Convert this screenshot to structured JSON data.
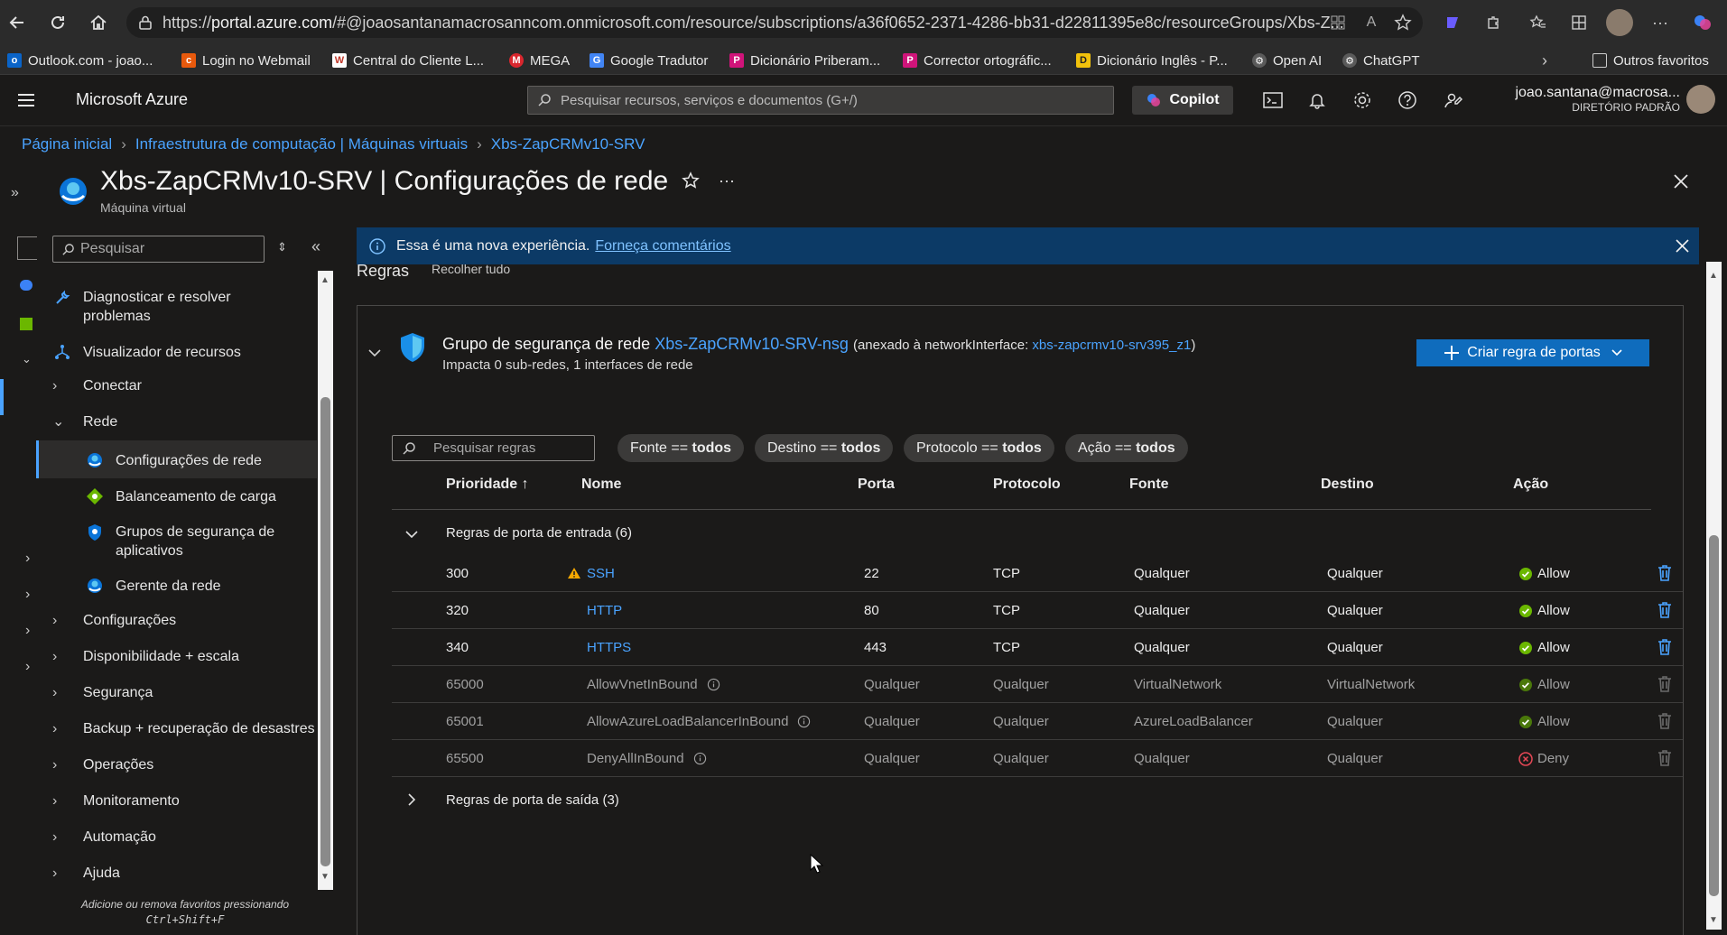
{
  "browser": {
    "url_prefix": "https://",
    "url_host": "portal.azure.com",
    "url_rest": "/#@joaosantanamacrosanncom.onmicrosoft.com/resource/subscriptions/a36f0652-2371-4286-bb31-d22811395e8c/resourceGroups/Xbs-Z...",
    "bookmarks": [
      {
        "label": "Outlook.com - joao...",
        "icon": "outlook-icon",
        "color": "#0a64c8"
      },
      {
        "label": "Login no Webmail",
        "icon": "cpanel-icon",
        "color": "#e8590c"
      },
      {
        "label": "Central do Cliente L...",
        "icon": "w-icon",
        "color": "#c0392b"
      },
      {
        "label": "MEGA",
        "icon": "mega-icon",
        "color": "#d9272e"
      },
      {
        "label": "Google Tradutor",
        "icon": "translate-icon",
        "color": "#4285f4"
      },
      {
        "label": "Dicionário Priberam...",
        "icon": "priberam-icon",
        "color": "#d0147a"
      },
      {
        "label": "Corrector ortográfic...",
        "icon": "priberam-icon",
        "color": "#d0147a"
      },
      {
        "label": "Dicionário Inglês - P...",
        "icon": "dictionary-icon",
        "color": "#f2c20c"
      },
      {
        "label": "Open AI",
        "icon": "openai-icon",
        "color": "#5a5a5a"
      },
      {
        "label": "ChatGPT",
        "icon": "openai-icon",
        "color": "#5a5a5a"
      }
    ],
    "other_favorites": "Outros favoritos"
  },
  "azure": {
    "brand": "Microsoft Azure",
    "search_placeholder": "Pesquisar recursos, serviços e documentos (G+/)",
    "copilot": "Copilot",
    "user_email": "joao.santana@macrosa...",
    "user_dir": "DIRETÓRIO PADRÃO"
  },
  "breadcrumb": [
    "Página inicial",
    "Infraestrutura de computação | Máquinas virtuais",
    "Xbs-ZapCRMv10-SRV"
  ],
  "page": {
    "title": "Xbs-ZapCRMv10-SRV | Configurações de rede",
    "subtitle": "Máquina virtual"
  },
  "side_menu": {
    "search_placeholder": "Pesquisar",
    "items": [
      {
        "label": "Diagnosticar e resolver",
        "label2": "problemas",
        "icon": "wrench-icon",
        "type": "icon"
      },
      {
        "label": "Visualizador de recursos",
        "icon": "hierarchy-icon",
        "type": "icon"
      },
      {
        "label": "Conectar",
        "type": "collapsed"
      },
      {
        "label": "Rede",
        "type": "expanded"
      },
      {
        "label": "Configurações de rede",
        "icon": "network-settings-icon",
        "type": "sub",
        "selected": true
      },
      {
        "label": "Balanceamento de carga",
        "icon": "load-balancer-icon",
        "type": "sub"
      },
      {
        "label": "Grupos de segurança de",
        "label2": "aplicativos",
        "icon": "shield-icon",
        "type": "sub"
      },
      {
        "label": "Gerente da rede",
        "icon": "network-manager-icon",
        "type": "sub"
      },
      {
        "label": "Configurações",
        "type": "collapsed"
      },
      {
        "label": "Disponibilidade + escala",
        "type": "collapsed"
      },
      {
        "label": "Segurança",
        "type": "collapsed"
      },
      {
        "label": "Backup + recuperação de desastres",
        "type": "collapsed"
      },
      {
        "label": "Operações",
        "type": "collapsed"
      },
      {
        "label": "Monitoramento",
        "type": "collapsed"
      },
      {
        "label": "Automação",
        "type": "collapsed"
      },
      {
        "label": "Ajuda",
        "type": "collapsed"
      }
    ],
    "hint_line1": "Adicione ou remova favoritos pressionando",
    "hint_line2": "Ctrl+Shift+F"
  },
  "banner": {
    "text": "Essa é uma nova experiência.",
    "link": "Forneça comentários"
  },
  "rules_heading": "Regras",
  "collapse_all": "Recolher tudo",
  "nsg": {
    "prefix": "Grupo de segurança de rede",
    "name": "Xbs-ZapCRMv10-SRV-nsg",
    "attached_prefix": "(anexado à networkInterface:",
    "attached_nic": "xbs-zapcrmv10-srv395_z1",
    "attached_suffix": ")",
    "impact": "Impacta 0 sub-redes, 1 interfaces de rede",
    "create_button": "Criar regra de portas"
  },
  "filters": {
    "search_placeholder": "Pesquisar regras",
    "pills": [
      {
        "key": "Fonte",
        "op": "==",
        "value": "todos"
      },
      {
        "key": "Destino",
        "op": "==",
        "value": "todos"
      },
      {
        "key": "Protocolo",
        "op": "==",
        "value": "todos"
      },
      {
        "key": "Ação",
        "op": "==",
        "value": "todos"
      }
    ]
  },
  "columns": [
    "Prioridade ↑",
    "Nome",
    "Porta",
    "Protocolo",
    "Fonte",
    "Destino",
    "Ação"
  ],
  "inbound_group": "Regras de porta de entrada (6)",
  "outbound_group": "Regras de porta de saída (3)",
  "rules": [
    {
      "priority": "300",
      "name": "SSH",
      "port": "22",
      "protocol": "TCP",
      "source": "Qualquer",
      "dest": "Qualquer",
      "action": "Allow",
      "warning": true,
      "default": false
    },
    {
      "priority": "320",
      "name": "HTTP",
      "port": "80",
      "protocol": "TCP",
      "source": "Qualquer",
      "dest": "Qualquer",
      "action": "Allow",
      "warning": false,
      "default": false
    },
    {
      "priority": "340",
      "name": "HTTPS",
      "port": "443",
      "protocol": "TCP",
      "source": "Qualquer",
      "dest": "Qualquer",
      "action": "Allow",
      "warning": false,
      "default": false
    },
    {
      "priority": "65000",
      "name": "AllowVnetInBound",
      "port": "Qualquer",
      "protocol": "Qualquer",
      "source": "VirtualNetwork",
      "dest": "VirtualNetwork",
      "action": "Allow",
      "warning": false,
      "default": true
    },
    {
      "priority": "65001",
      "name": "AllowAzureLoadBalancerInBound",
      "port": "Qualquer",
      "protocol": "Qualquer",
      "source": "AzureLoadBalancer",
      "dest": "Qualquer",
      "action": "Allow",
      "warning": false,
      "default": true
    },
    {
      "priority": "65500",
      "name": "DenyAllInBound",
      "port": "Qualquer",
      "protocol": "Qualquer",
      "source": "Qualquer",
      "dest": "Qualquer",
      "action": "Deny",
      "warning": false,
      "default": true
    }
  ],
  "colors": {
    "accent": "#0f6cbd",
    "link": "#4aa3ff",
    "allow": "#6bb700",
    "deny": "#e74856",
    "warning": "#f7a800"
  }
}
